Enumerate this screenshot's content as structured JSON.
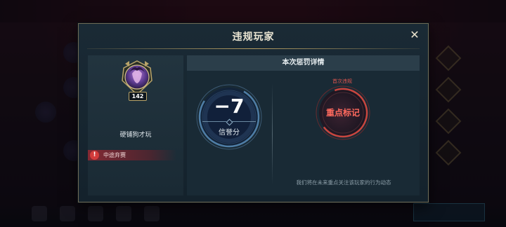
{
  "modal": {
    "title": "违规玩家",
    "close_glyph": "✕"
  },
  "player": {
    "level": "142",
    "name": "硬铺狗才玩",
    "violation": "中途弃赛",
    "violation_glyph": "!"
  },
  "penalty": {
    "header": "本次惩罚详情",
    "credit_change": "−7",
    "credit_label": "信誉分",
    "occurrence": "首次违规",
    "action": "重点标记",
    "note": "我们将在未来重点关注该玩家的行为动态"
  },
  "colors": {
    "accent_red": "#ff6a5e",
    "gold_border": "#b79e62",
    "panel_bg": "#192a35"
  }
}
